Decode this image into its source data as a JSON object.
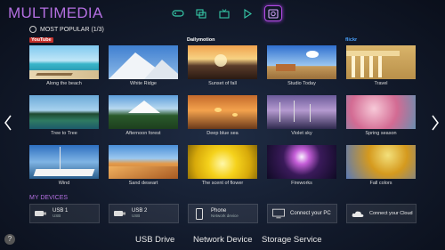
{
  "app": {
    "title": "MULTIMEDIA"
  },
  "topbar": {
    "icons": [
      "gamepad-icon",
      "photos-icon",
      "tv-icon",
      "play-icon",
      "multimedia-icon"
    ]
  },
  "section": {
    "title": "MOST POPULAR (1/3)"
  },
  "providers": {
    "youtube": "YouTube",
    "dailymotion": "Dailymotion",
    "flickr": "flickr"
  },
  "tiles": [
    {
      "caption": "Along the beach"
    },
    {
      "caption": "White Ridge"
    },
    {
      "caption": "Sunset of fall"
    },
    {
      "caption": "Studio Today"
    },
    {
      "caption": "Travel"
    },
    {
      "caption": "Tree to Tree"
    },
    {
      "caption": "Afternoon forest"
    },
    {
      "caption": "Deep blue sea"
    },
    {
      "caption": "Violet sky"
    },
    {
      "caption": "Spring season"
    },
    {
      "caption": "Wind"
    },
    {
      "caption": "Sand deseart"
    },
    {
      "caption": "The scent of flower"
    },
    {
      "caption": "Fireworks"
    },
    {
      "caption": "Fall colors"
    }
  ],
  "devices": {
    "heading": "MY DEVICES",
    "items": [
      {
        "name": "USB 1",
        "sub": "USB"
      },
      {
        "name": "USB 2",
        "sub": "USB"
      },
      {
        "name": "Phone",
        "sub": "Network device"
      },
      {
        "name": "Connect your PC",
        "sub": ""
      },
      {
        "name": "Connect your Cloud",
        "sub": ""
      }
    ]
  },
  "bottom_nav": {
    "usb": "USB Drive",
    "network": "Network Device",
    "storage": "Storage Service"
  },
  "help": {
    "label": "?"
  },
  "colors": {
    "accent": "#b36fe0",
    "topbar_icon": "#36c9a8"
  }
}
